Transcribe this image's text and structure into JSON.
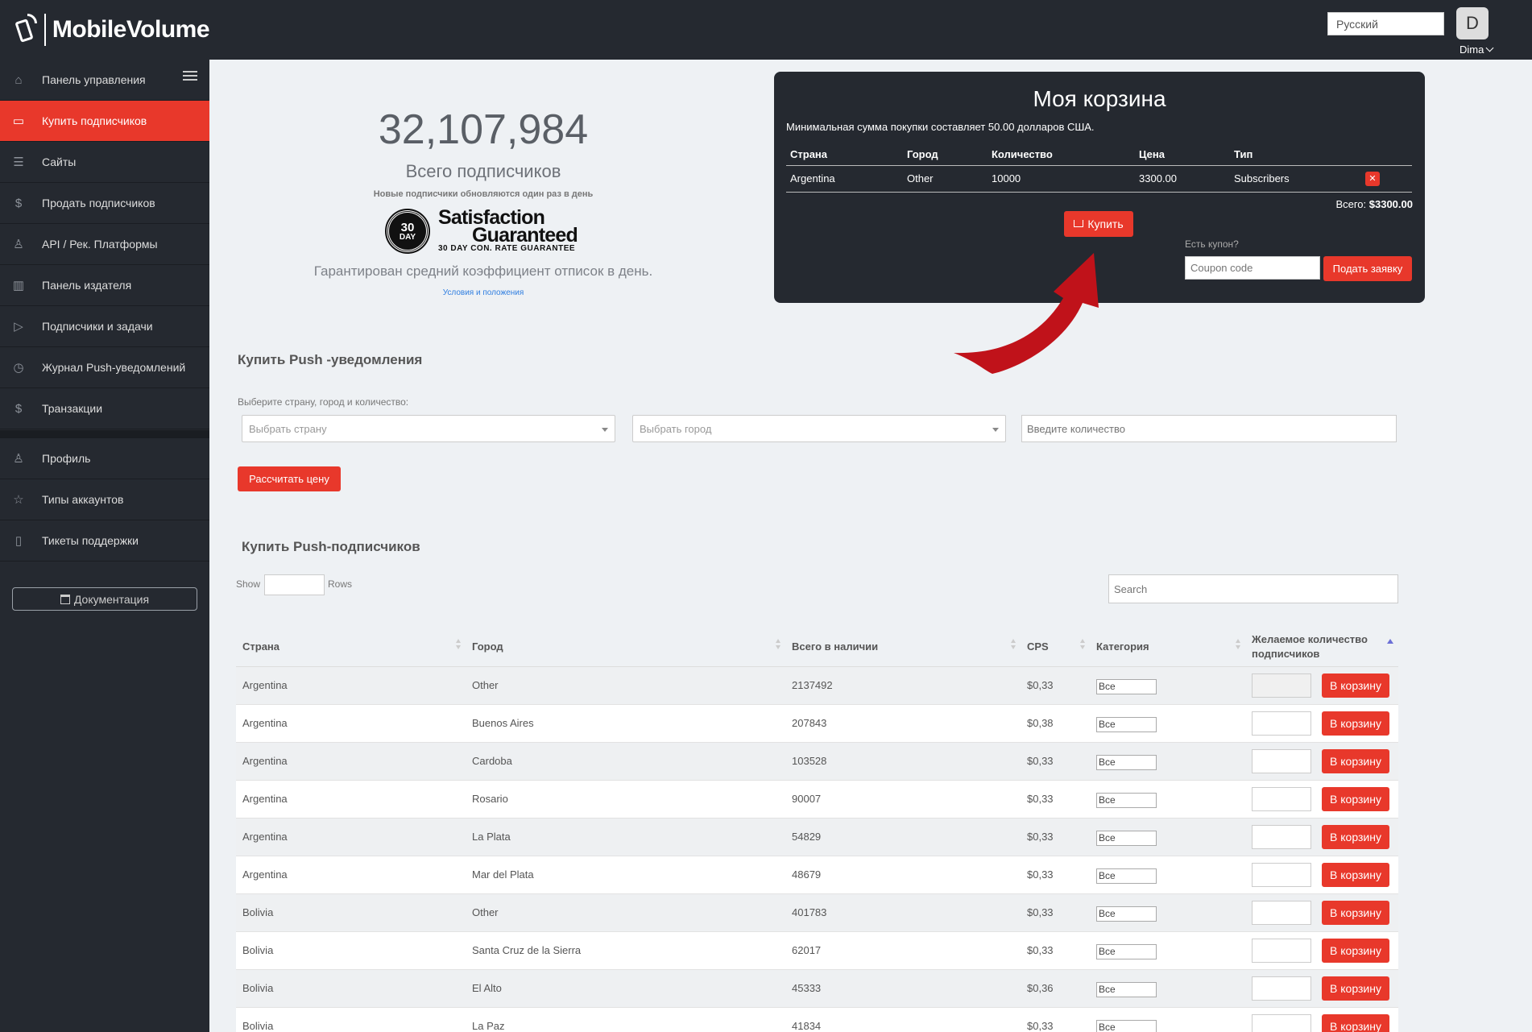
{
  "brand": {
    "name": "MobileVolume"
  },
  "header": {
    "language_value": "Русский",
    "avatar_letter": "D",
    "user_name": "Dima"
  },
  "sidebar": {
    "items": [
      {
        "label": "Панель управления",
        "icon": "home-icon",
        "glyph": "⌂"
      },
      {
        "label": "Купить подписчиков",
        "icon": "card-icon",
        "glyph": "▭"
      },
      {
        "label": "Сайты",
        "icon": "list-icon",
        "glyph": "☰"
      },
      {
        "label": "Продать подписчиков",
        "icon": "dollar-icon",
        "glyph": "$"
      },
      {
        "label": "API / Рек. Платформы",
        "icon": "flask-icon",
        "glyph": "♙"
      },
      {
        "label": "Панель издателя",
        "icon": "equalizer-icon",
        "glyph": "▥"
      },
      {
        "label": "Подписчики и задачи",
        "icon": "play-icon",
        "glyph": "▷"
      },
      {
        "label": "Журнал Push-уведомлений",
        "icon": "clock-icon",
        "glyph": "◷"
      },
      {
        "label": "Транзакции",
        "icon": "dollar-icon",
        "glyph": "$"
      },
      {
        "label": "Профиль",
        "icon": "user-icon",
        "glyph": "♙"
      },
      {
        "label": "Типы аккаунтов",
        "icon": "star-icon",
        "glyph": "☆"
      },
      {
        "label": "Тикеты поддержки",
        "icon": "ticket-icon",
        "glyph": "▯"
      }
    ],
    "doc_button": "Документация"
  },
  "stats": {
    "total_count": "32,107,984",
    "total_label": "Всего подписчиков",
    "update_note": "Новые подписчики обновляются один раз в день",
    "badge_day": "30",
    "badge_day_label": "DAY",
    "badge_line1": "Satisfaction",
    "badge_line2": "Guaranteed",
    "badge_line3": "30 DAY CON. RATE GUARANTEE",
    "guarantee_text": "Гарантирован средний коэффициент отписок в день.",
    "terms_link": "Условия и положения"
  },
  "cart": {
    "title": "Моя корзина",
    "min_note": "Минимальная сумма покупки составляет 50.00 долларов США.",
    "columns": [
      "Страна",
      "Город",
      "Количество",
      "Цена",
      "Тип"
    ],
    "rows": [
      {
        "country": "Argentina",
        "city": "Other",
        "qty": "10000",
        "price": "3300.00",
        "type": "Subscribers"
      }
    ],
    "total_label": "Всего:",
    "total_value": "$3300.00",
    "buy_label": "Купить",
    "coupon_question": "Есть купон?",
    "coupon_placeholder": "Coupon code",
    "coupon_submit": "Подать заявку"
  },
  "push_notifications": {
    "title": "Купить Push -уведомления",
    "form_label": "Выберите страну, город и количество:",
    "country_placeholder": "Выбрать страну",
    "city_placeholder": "Выбрать город",
    "qty_placeholder": "Введите количество",
    "calc_button": "Рассчитать цену"
  },
  "subscribers": {
    "title": "Купить Push-подписчиков",
    "show_label": "Show",
    "rows_label": "Rows",
    "search_placeholder": "Search",
    "columns": {
      "country": "Страна",
      "city": "Город",
      "available": "Всего в наличии",
      "cps": "CPS",
      "category": "Категория",
      "desired": "Желаемое количество подписчиков"
    },
    "add_label": "В корзину",
    "rows": [
      {
        "country": "Argentina",
        "city": "Other",
        "available": "2137492",
        "cps": "$0,33",
        "category": "Все"
      },
      {
        "country": "Argentina",
        "city": "Buenos Aires",
        "available": "207843",
        "cps": "$0,38",
        "category": "Все"
      },
      {
        "country": "Argentina",
        "city": "Cardoba",
        "available": "103528",
        "cps": "$0,33",
        "category": "Все"
      },
      {
        "country": "Argentina",
        "city": "Rosario",
        "available": "90007",
        "cps": "$0,33",
        "category": "Все"
      },
      {
        "country": "Argentina",
        "city": "La Plata",
        "available": "54829",
        "cps": "$0,33",
        "category": "Все"
      },
      {
        "country": "Argentina",
        "city": "Mar del Plata",
        "available": "48679",
        "cps": "$0,33",
        "category": "Все"
      },
      {
        "country": "Bolivia",
        "city": "Other",
        "available": "401783",
        "cps": "$0,33",
        "category": "Все"
      },
      {
        "country": "Bolivia",
        "city": "Santa Cruz de la Sierra",
        "available": "62017",
        "cps": "$0,33",
        "category": "Все"
      },
      {
        "country": "Bolivia",
        "city": "El Alto",
        "available": "45333",
        "cps": "$0,36",
        "category": "Все"
      },
      {
        "country": "Bolivia",
        "city": "La Paz",
        "available": "41834",
        "cps": "$0,33",
        "category": "Все"
      }
    ]
  },
  "colors": {
    "accent": "#e8382b",
    "dark": "#252930",
    "page_bg": "#eef1f4"
  }
}
